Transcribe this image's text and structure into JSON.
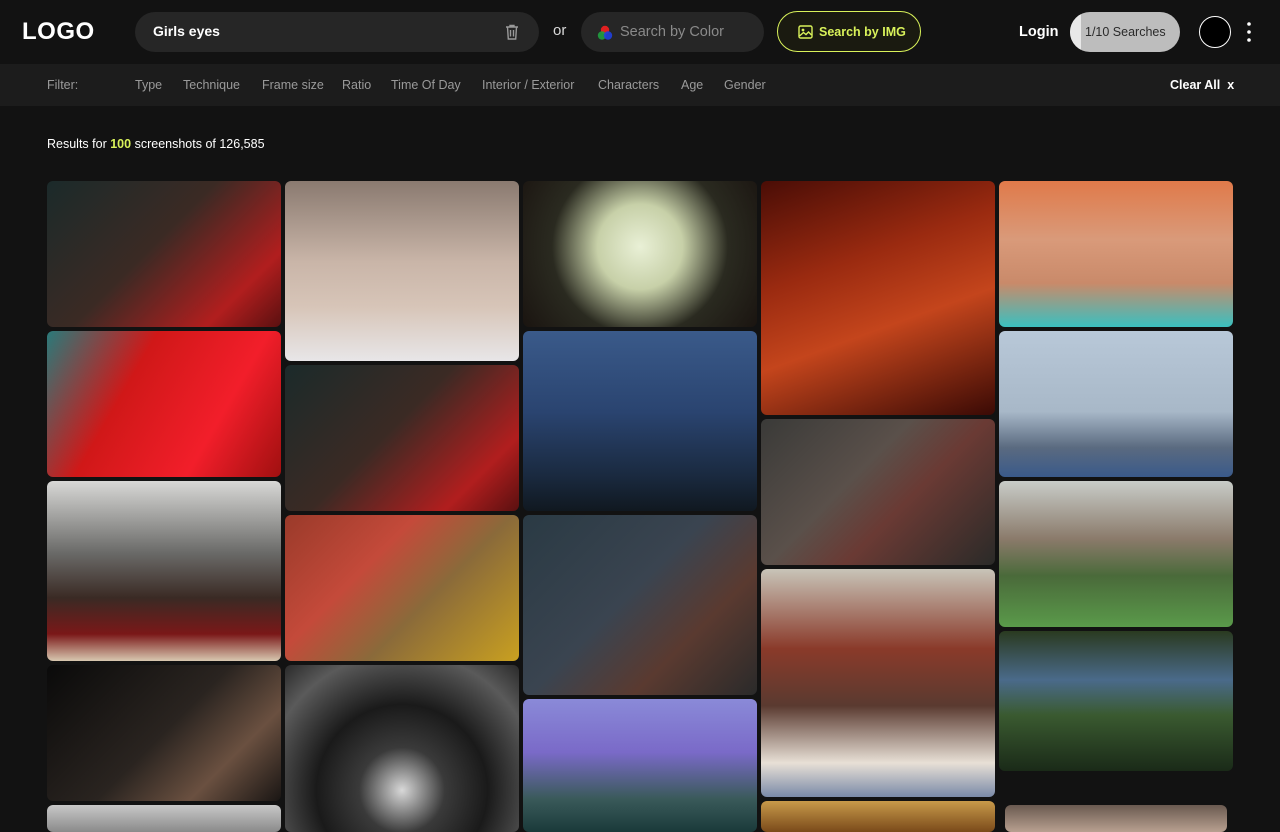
{
  "header": {
    "logo": "LOGO",
    "search_value": "Girls eyes",
    "or_label": "or",
    "color_search_placeholder": "Search by Color",
    "img_search_label": "Search by IMG",
    "login_label": "Login",
    "searches_counter": "1/10 Searches",
    "searches_used_fraction": 0.1
  },
  "filters": {
    "label": "Filter:",
    "items": [
      "Type",
      "Technique",
      "Frame size",
      "Ratio",
      "Time Of Day",
      "Interior / Exterior",
      "Characters",
      "Age",
      "Gender"
    ],
    "clear_all": "Clear All",
    "clear_all_x": "x"
  },
  "results": {
    "prefix": "Results for",
    "count": "100",
    "suffix": "screenshots of 126,585"
  },
  "colors": {
    "accent": "#d9f25a",
    "background": "#121212",
    "filter_bar": "#1c1c1c"
  },
  "tiles": [
    {
      "name": "man-red-jacket-night",
      "bg": "linear-gradient(135deg,#1b2a2a 0%,#3b2a24 45%,#b11e1e 80%,#5a1010 100%)"
    },
    {
      "name": "close-up-woman-hair",
      "bg": "linear-gradient(180deg,#8a7a70 0%,#c9b5a8 45%,#d7c5b8 70%,#e8e6e8 100%)"
    },
    {
      "name": "fisheye-boy-cap",
      "bg": "radial-gradient(circle at 50% 45%,#e9f0d6 0%,#c7d0a8 30%,#2a2a20 62%,#1a1410 100%)"
    },
    {
      "name": "hand-holding-oscar",
      "bg": "linear-gradient(160deg,#4a0d06 0%,#9a2a10 35%,#c4451c 60%,#3a0a05 100%)"
    },
    {
      "name": "face-teal-tint",
      "bg": "linear-gradient(180deg,#e07a4a 0%,#d99a7a 40%,#c98a6a 70%,#3ac0c0 100%)"
    },
    {
      "name": "red-face-teal-hair",
      "bg": "linear-gradient(120deg,#2a7a7a 0%,#d01818 35%,#f21e2a 70%,#a01010 100%)"
    },
    {
      "name": "shirt-on-clothesline",
      "bg": "linear-gradient(180deg,#3a5a8a 0%,#2a4470 45%,#1a2a40 80%,#101820 100%)"
    },
    {
      "name": "crowd-motion-blur",
      "bg": "linear-gradient(135deg,#3a3a38 0%,#5a504a 40%,#6a3a34 60%,#2a2a28 100%)"
    },
    {
      "name": "medusa-hair-woman",
      "bg": "linear-gradient(180deg,#b8c8d8 0%,#a8b8c8 55%,#5a6a80 80%,#3a5a8a 100%)"
    },
    {
      "name": "man-on-throne-table",
      "bg": "linear-gradient(180deg,#d8d8d6 0%,#6a6a68 40%,#3a2a24 65%,#7a1818 85%,#d8c8b0 100%)"
    },
    {
      "name": "nicolas-cage-titles",
      "bg": "linear-gradient(135deg,#9a3a2a 0%,#c44a3a 35%,#8a6a3a 60%,#c9a020 100%)"
    },
    {
      "name": "blurred-man-chair",
      "bg": "linear-gradient(135deg,#2a3a44 0%,#3a4450 45%,#5a3a30 70%,#2a2a2a 100%)"
    },
    {
      "name": "woman-striped-jacket",
      "bg": "linear-gradient(180deg,#c8c4b8 0%,#8a3a2a 35%,#5a3a30 60%,#e8e0d6 85%,#7a8aa8 100%)"
    },
    {
      "name": "man-green-field",
      "bg": "linear-gradient(180deg,#c8ccc8 0%,#8a7a6a 40%,#4a6a3a 65%,#5a9a4a 100%)"
    },
    {
      "name": "man-phone-dark",
      "bg": "linear-gradient(135deg,#0a0a0a 0%,#2a2420 50%,#6a5040 75%,#1a1614 100%)"
    },
    {
      "name": "checkerboard-eye",
      "bg": "radial-gradient(circle at 50% 75%,#d8d8d8 0%,#3a3a3a 25%,#1a1a1a 50%,#5a5a5a 80%,#2a2a2a 100%)"
    },
    {
      "name": "man-purple-sky",
      "bg": "linear-gradient(180deg,#8a8ad8 0%,#7a6ac8 40%,#3a5a5a 75%,#1a3a3a 100%)"
    },
    {
      "name": "river-motion-blur",
      "bg": "linear-gradient(180deg,#2a3a20 0%,#4a6a8a 35%,#3a5a30 60%,#1a2a18 100%)"
    },
    {
      "name": "room-partial-bottom",
      "bg": "linear-gradient(180deg,#c8c8c8 0%,#8a8a8a 100%)"
    },
    {
      "name": "warm-partial-bottom",
      "bg": "linear-gradient(180deg,#c89a4a 0%,#7a4a1a 100%)"
    },
    {
      "name": "face-partial-bottom",
      "bg": "linear-gradient(180deg,#6a5a50 0%,#b8a090 100%)"
    }
  ]
}
